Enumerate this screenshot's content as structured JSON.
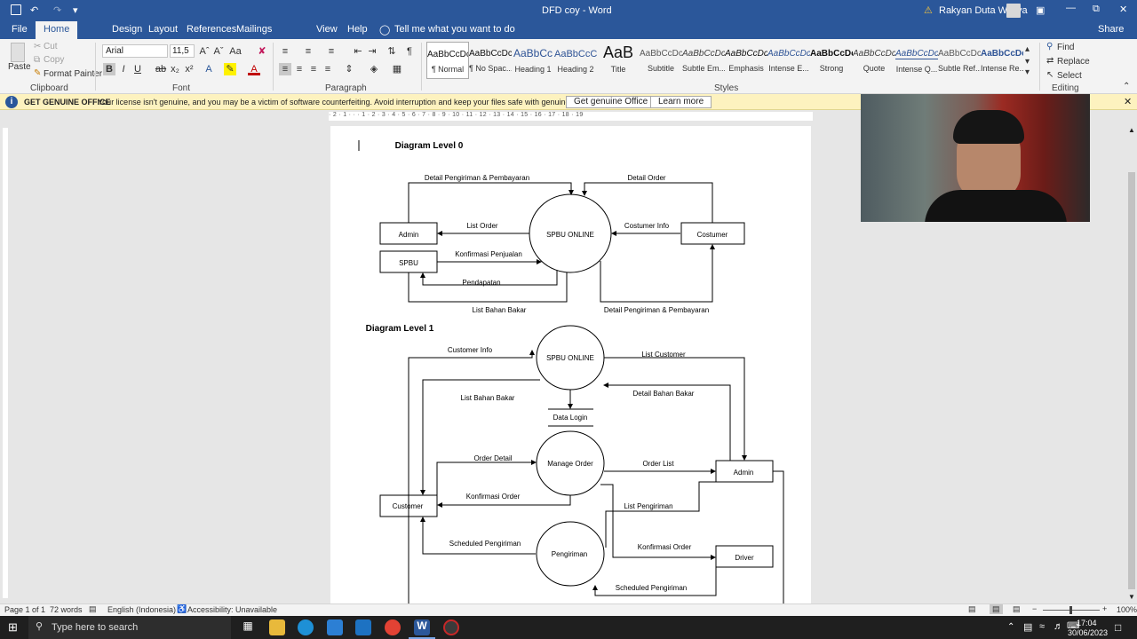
{
  "window": {
    "title": "DFD coy  -  Word",
    "user": "Rakyan Duta Wijaya"
  },
  "tabs": [
    "File",
    "Home",
    "Design",
    "Layout",
    "References",
    "Mailings",
    "View",
    "Help"
  ],
  "tell_me": "Tell me what you want to do",
  "share": "Share",
  "clipboard": {
    "cut": "Cut",
    "copy": "Copy",
    "format_painter": "Format Painter",
    "paste": "Paste",
    "label": "Clipboard"
  },
  "font": {
    "name": "Arial",
    "size": "11,5",
    "label": "Font"
  },
  "paragraph": {
    "label": "Paragraph"
  },
  "styles": {
    "label": "Styles",
    "items": [
      {
        "preview": "AaBbCcDc",
        "name": "¶ Normal"
      },
      {
        "preview": "AaBbCcDc",
        "name": "¶ No Spac..."
      },
      {
        "preview": "AaBbCc",
        "name": "Heading 1"
      },
      {
        "preview": "AaBbCcC",
        "name": "Heading 2"
      },
      {
        "preview": "AaB",
        "name": "Title"
      },
      {
        "preview": "AaBbCcDc",
        "name": "Subtitle"
      },
      {
        "preview": "AaBbCcDc",
        "name": "Subtle Em..."
      },
      {
        "preview": "AaBbCcDc",
        "name": "Emphasis"
      },
      {
        "preview": "AaBbCcDc",
        "name": "Intense E..."
      },
      {
        "preview": "AaBbCcDc",
        "name": "Strong"
      },
      {
        "preview": "AaBbCcDc",
        "name": "Quote"
      },
      {
        "preview": "AaBbCcDc",
        "name": "Intense Q..."
      },
      {
        "preview": "AaBbCcDc",
        "name": "Subtle Ref..."
      },
      {
        "preview": "AaBbCcDc",
        "name": "Intense Re..."
      }
    ]
  },
  "editing": {
    "find": "Find",
    "replace": "Replace",
    "select": "Select",
    "label": "Editing"
  },
  "banner": {
    "title": "GET GENUINE OFFICE",
    "message": "Your license isn't genuine, and you may be a victim of software counterfeiting. Avoid interruption and keep your files safe with genuine Office today.",
    "btn1": "Get genuine Office",
    "btn2": "Learn more"
  },
  "ruler": {
    "marks": "· 2 · 1 · · · 1 · 2 · 3 · 4 · 5 · 6 · 7 · 8 · 9 · 10 · 11 · 12 · 13 · 14 · 15 · 16 · 17 · 18 · 19"
  },
  "doc": {
    "level0": {
      "heading": "Diagram Level 0",
      "admin": "Admin",
      "spbu": "SPBU",
      "process": "SPBU  ONLINE",
      "costumer": "Costumer",
      "f1": "Detail Pengiriman & Pembayaran",
      "f2": "Detail Order",
      "f3": "List Order",
      "f4": "Costumer Info",
      "f5": "Konfirmasi  Penjualan",
      "f6": "Pendapatan",
      "f7": "List Bahan  Bakar",
      "f8": "Detail Pengiriman  & Pembayaran"
    },
    "level1": {
      "heading": "Diagram  Level 1",
      "p1": "SPBU  ONLINE",
      "p2": "Manage  Order",
      "p3": "Pengiriman",
      "customer": "Customer",
      "admin": "Admin",
      "driver": "Driver",
      "store": "Data Login",
      "f1": "Customer Info",
      "f2": "List Customer",
      "f3": "List Bahan Bakar",
      "f4": "Detail Bahan Bakar",
      "f5": "Order Detail",
      "f6": "Order List",
      "f7": "Konfirmasi  Order",
      "f8": "List Pengiriman",
      "f9": "Scheduled  Pengiriman",
      "f10": "Konfirmasi  Order",
      "f11": "Scheduled  Pengiriman"
    }
  },
  "status": {
    "page": "Page 1 of 1",
    "words": "72 words",
    "lang": "English (Indonesia)",
    "access": "Accessibility: Unavailable",
    "zoom": "100%"
  },
  "taskbar": {
    "search": "Type here to search",
    "time": "17:04",
    "date": "30/06/2023"
  }
}
